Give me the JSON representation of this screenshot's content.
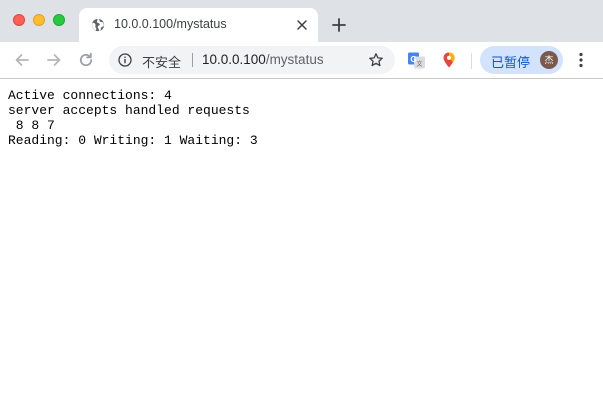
{
  "window": {
    "controls": [
      "close",
      "minimize",
      "maximize"
    ]
  },
  "tab": {
    "favicon": "globe-icon",
    "title": "10.0.0.100/mystatus",
    "close_icon": "close-icon"
  },
  "newtab": {
    "icon": "plus-icon"
  },
  "toolbar": {
    "back_icon": "arrow-left-icon",
    "forward_icon": "arrow-right-icon",
    "reload_icon": "reload-icon",
    "omnibox": {
      "info_icon": "info-icon",
      "security_label": "不安全",
      "url_host": "10.0.0.100",
      "url_path": "/mystatus",
      "bookmark_icon": "star-icon"
    },
    "extensions": [
      "translate-icon",
      "map-pin-icon"
    ],
    "profile": {
      "label": "已暂停",
      "avatar_text": "杰"
    },
    "menu_icon": "more-vertical-icon"
  },
  "page": {
    "lines": [
      "Active connections: 4",
      "server accepts handled requests",
      " 8 8 7",
      "Reading: 0 Writing: 1 Waiting: 3"
    ]
  },
  "colors": {
    "tabstrip_bg": "#dee1e6",
    "omnibox_bg": "#f1f3f4",
    "profile_bg": "#d3e3fd",
    "profile_text": "#0b57d0",
    "close_red": "#ff5f57",
    "minimize_yellow": "#febc2e",
    "maximize_green": "#28c840"
  }
}
